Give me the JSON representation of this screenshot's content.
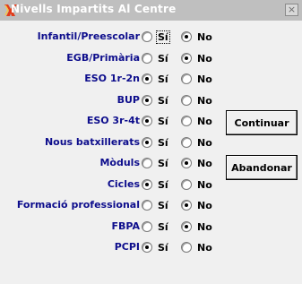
{
  "window": {
    "title": "Nivells Impartits Al Centre",
    "close_label": "×"
  },
  "options": {
    "yes": "Sí",
    "no": "No"
  },
  "levels": [
    {
      "label": "Infantil/Preescolar",
      "selected": "no"
    },
    {
      "label": "EGB/Primària",
      "selected": "no"
    },
    {
      "label": "ESO 1r-2n",
      "selected": "si"
    },
    {
      "label": "BUP",
      "selected": "si"
    },
    {
      "label": "ESO 3r-4t",
      "selected": "si"
    },
    {
      "label": "Nous batxillerats",
      "selected": "si"
    },
    {
      "label": "Mòduls",
      "selected": "no"
    },
    {
      "label": "Cicles",
      "selected": "si"
    },
    {
      "label": "Formació professional",
      "selected": "no"
    },
    {
      "label": "FBPA",
      "selected": "no"
    },
    {
      "label": "PCPI",
      "selected": "si"
    }
  ],
  "buttons": {
    "continue": "Continuar",
    "cancel": "Abandonar"
  },
  "colors": {
    "label_text": "#0d0d8c",
    "title_bar": "#bfbfbf",
    "dialog_background": "#f0f0f0"
  }
}
